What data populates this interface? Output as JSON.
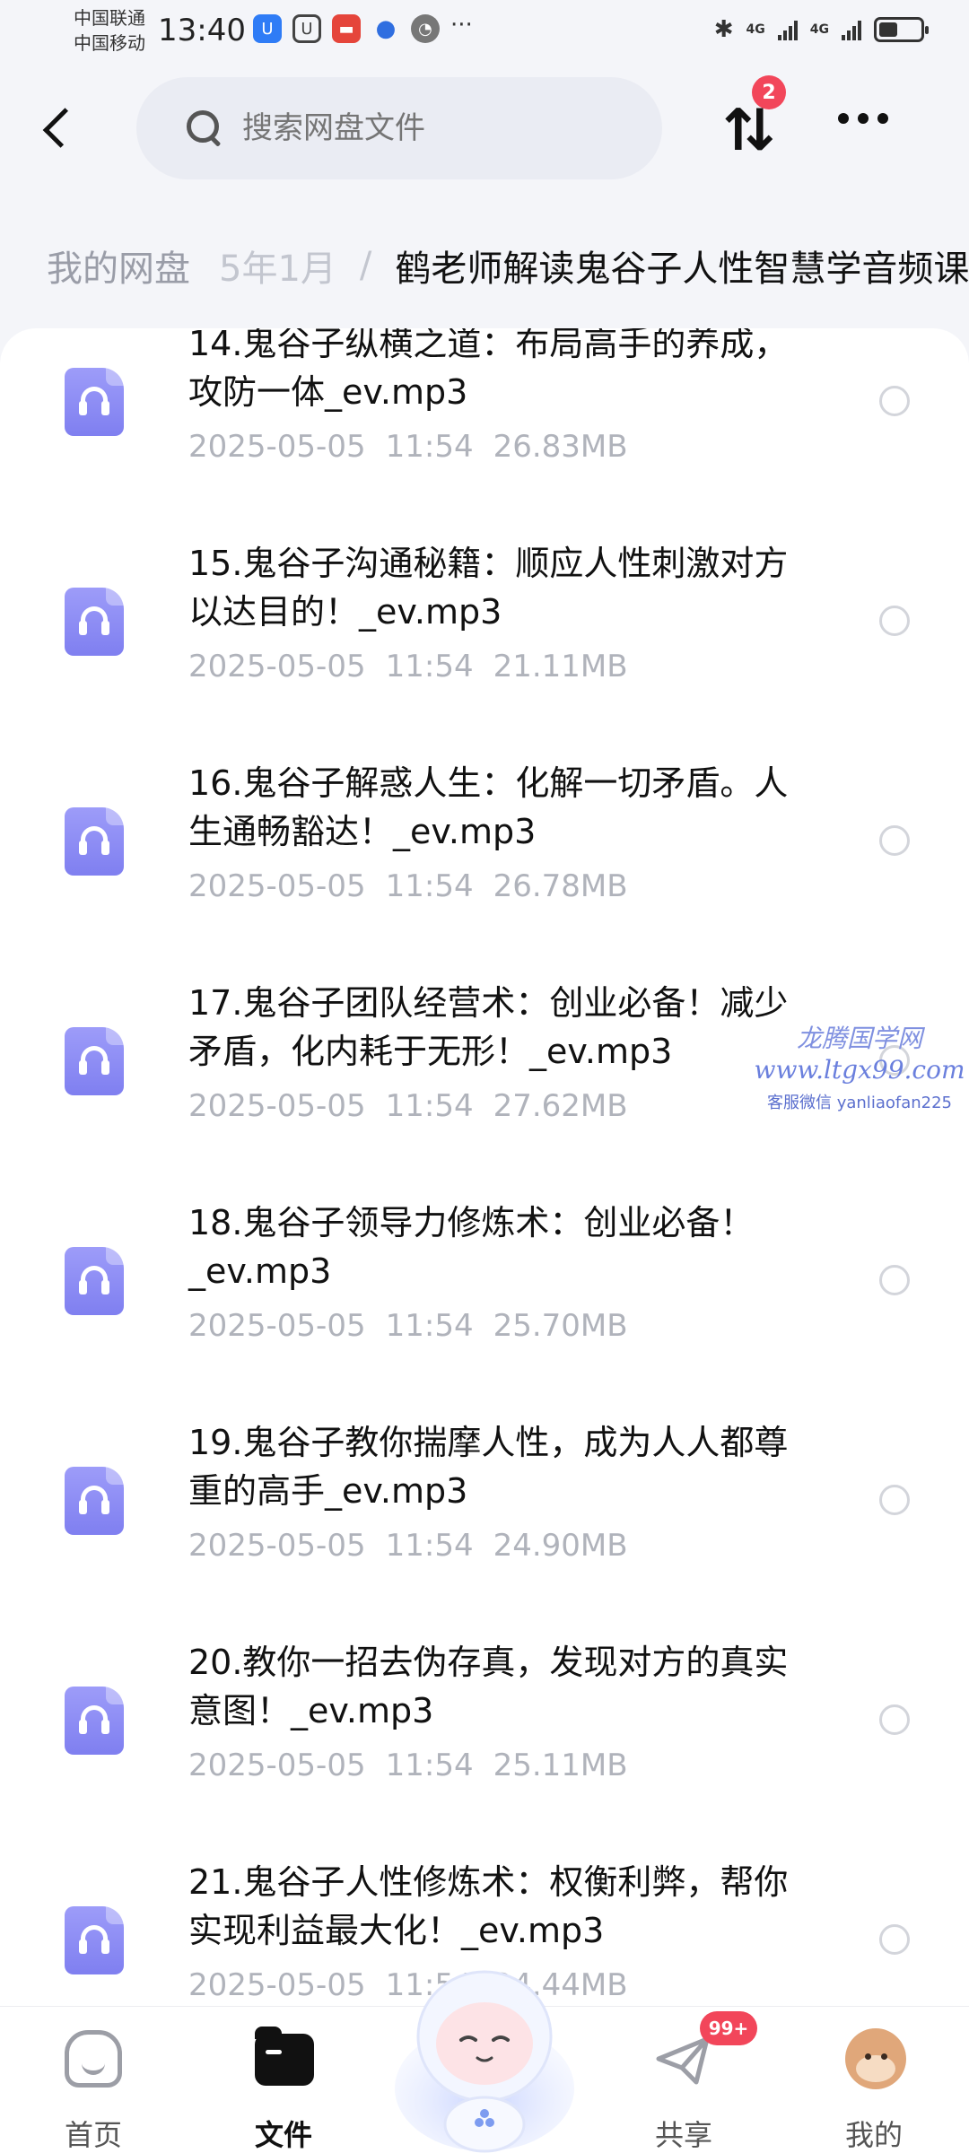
{
  "status_bar": {
    "carrier_1": "中国联通",
    "carrier_2": "中国移动",
    "time": "13:40",
    "more_dots": "···",
    "net_1": "4G",
    "net_2": "4G",
    "battery_level": 0.45
  },
  "header": {
    "search_placeholder": "搜索网盘文件",
    "transfer_badge": "2"
  },
  "breadcrumb": {
    "root": "我的网盘",
    "middle": "5年1月",
    "separator": "/",
    "current": "鹤老师解读鬼谷子人性智慧学音频课"
  },
  "files": [
    {
      "name": "14.鬼谷子纵横之道：布局高手的养成，攻防一体_ev.mp3",
      "date": "2025-05-05",
      "time": "11:54",
      "size": "26.83MB"
    },
    {
      "name": "15.鬼谷子沟通秘籍：顺应人性刺激对方以达目的！_ev.mp3",
      "date": "2025-05-05",
      "time": "11:54",
      "size": "21.11MB"
    },
    {
      "name": "16.鬼谷子解惑人生：化解一切矛盾。人生通畅豁达！_ev.mp3",
      "date": "2025-05-05",
      "time": "11:54",
      "size": "26.78MB"
    },
    {
      "name": "17.鬼谷子团队经营术：创业必备！减少矛盾，化内耗于无形！_ev.mp3",
      "date": "2025-05-05",
      "time": "11:54",
      "size": "27.62MB"
    },
    {
      "name": "18.鬼谷子领导力修炼术：创业必备！_ev.mp3",
      "date": "2025-05-05",
      "time": "11:54",
      "size": "25.70MB"
    },
    {
      "name": "19.鬼谷子教你揣摩人性，成为人人都尊重的高手_ev.mp3",
      "date": "2025-05-05",
      "time": "11:54",
      "size": "24.90MB"
    },
    {
      "name": "20.教你一招去伪存真，发现对方的真实意图！_ev.mp3",
      "date": "2025-05-05",
      "time": "11:54",
      "size": "25.11MB"
    },
    {
      "name": "21.鬼谷子人性修炼术：权衡利弊，帮你实现利益最大化！_ev.mp3",
      "date": "2025-05-05",
      "time": "11:54",
      "size": "24.44MB"
    }
  ],
  "watermark": {
    "title": "龙腾国学网",
    "url": "www.ltgx99.com",
    "contact": "客服微信 yanliaofan225"
  },
  "bottom_nav": {
    "home": "首页",
    "files": "文件",
    "share": "共享",
    "share_badge": "99+",
    "mine": "我的"
  },
  "colors": {
    "accent": "#7f7ff0",
    "badge": "#f2465a"
  }
}
